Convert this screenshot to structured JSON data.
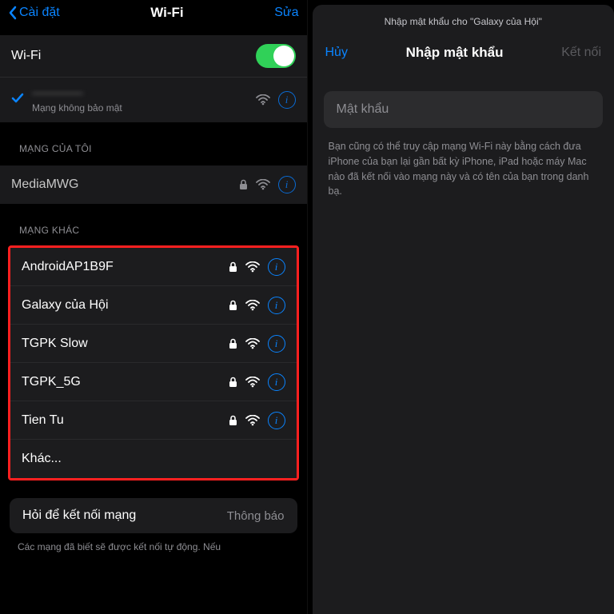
{
  "left": {
    "nav": {
      "back": "Cài đặt",
      "title": "Wi-Fi",
      "edit": "Sửa"
    },
    "wifi_toggle_label": "Wi-Fi",
    "connected": {
      "name": "————",
      "sub": "Mạng không bảo mật"
    },
    "my_header": "MẠNG CỦA TÔI",
    "my_networks": [
      {
        "name": "MediaMWG"
      }
    ],
    "other_header": "MẠNG KHÁC",
    "other_networks": [
      {
        "name": "AndroidAP1B9F"
      },
      {
        "name": "Galaxy của Hội"
      },
      {
        "name": "TGPK Slow"
      },
      {
        "name": "TGPK_5G"
      },
      {
        "name": "Tien Tu"
      }
    ],
    "other_more": "Khác...",
    "ask": {
      "label": "Hỏi để kết nối mạng",
      "value": "Thông báo"
    },
    "footer": "Các mạng đã biết sẽ được kết nối tự động. Nếu"
  },
  "right": {
    "caption": "Nhập mật khẩu cho \"Galaxy của Hội\"",
    "cancel": "Hủy",
    "title": "Nhập mật khẩu",
    "connect": "Kết nối",
    "placeholder": "Mật khẩu",
    "helper": "Bạn cũng có thể truy cập mạng Wi-Fi này bằng cách đưa iPhone của bạn lại gần bất kỳ iPhone, iPad hoặc máy Mac nào đã kết nối vào mạng này và có tên của bạn trong danh bạ."
  }
}
